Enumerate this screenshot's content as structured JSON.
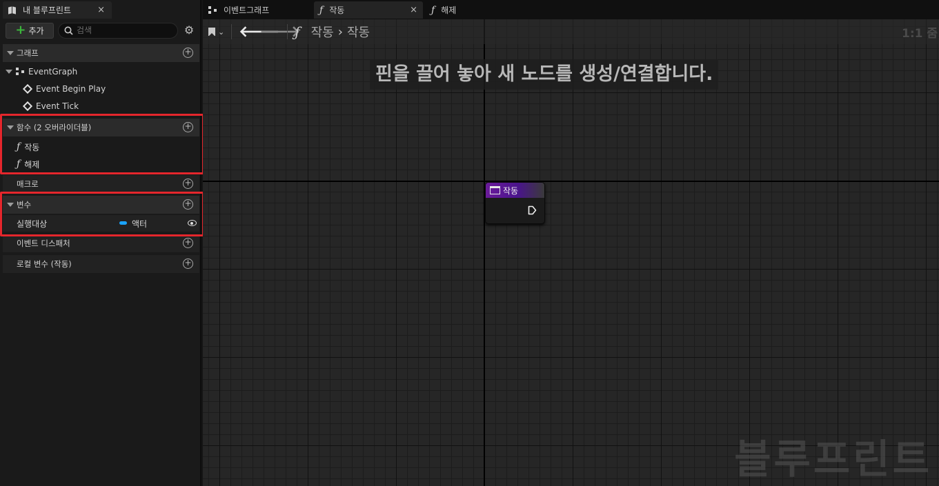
{
  "left_panel": {
    "tab_title": "내 블루프린트",
    "tab_close": "×",
    "toolbar": {
      "add_label": "추가",
      "search_placeholder": "검색"
    },
    "sections": {
      "graphs": {
        "label": "그래프",
        "graph_name": "EventGraph",
        "events": [
          "Event Begin Play",
          "Event Tick"
        ]
      },
      "functions": {
        "label": "함수 (2 오버라이더블)",
        "items": [
          "작동",
          "해제"
        ]
      },
      "macros": {
        "label": "매크로"
      },
      "variables": {
        "label": "변수",
        "items": [
          {
            "name": "실행대상",
            "type": "액터",
            "type_color": "#1aa3ff"
          }
        ]
      },
      "dispatchers": {
        "label": "이벤트 디스패처"
      },
      "local_vars": {
        "label": "로컬 변수 (작동)"
      }
    }
  },
  "tabs": [
    {
      "label": "이벤트그래프",
      "icon": "graph-icon",
      "active": false
    },
    {
      "label": "작동",
      "icon": "function-icon",
      "active": true,
      "close": "×"
    },
    {
      "label": "해제",
      "icon": "function-icon",
      "active": false
    }
  ],
  "graph": {
    "breadcrumb": [
      "작동",
      "작동"
    ],
    "zoom": "1:1 줌",
    "hint": "핀을 끌어 놓아 새 노드를 생성/연결합니다.",
    "node": {
      "title": "작동",
      "header_color": "#6a1b9a"
    },
    "watermark": "블루프린트"
  },
  "colors": {
    "highlight": "#e5262c",
    "add_plus": "#3cb73c"
  }
}
